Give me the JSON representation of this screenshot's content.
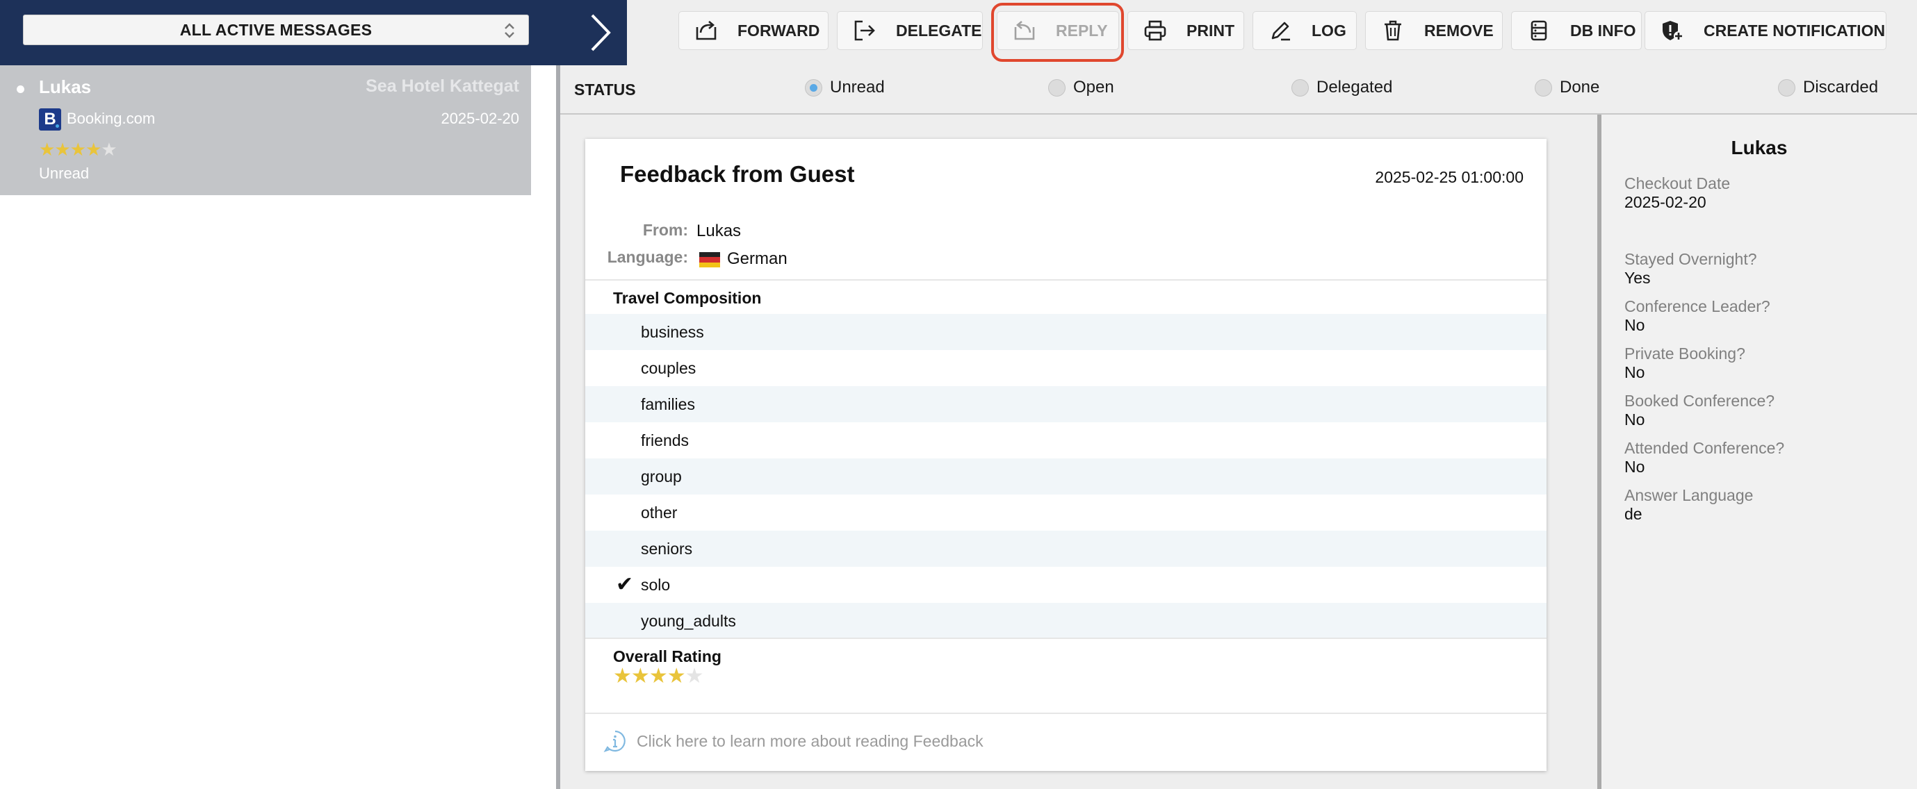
{
  "header": {
    "message_filter": "ALL ACTIVE MESSAGES"
  },
  "toolbar": {
    "forward": "FORWARD",
    "delegate": "DELEGATE",
    "reply": "REPLY",
    "print": "PRINT",
    "log": "LOG",
    "remove": "REMOVE",
    "db_info": "DB INFO",
    "create_notification": "CREATE NOTIFICATION",
    "highlighted_button": "REPLY"
  },
  "message_list": [
    {
      "name": "Lukas",
      "hotel": "Sea Hotel Kattegat",
      "source": "Booking.com",
      "source_logo_letter": "B",
      "date": "2025-02-20",
      "rating": 4,
      "rating_max": 5,
      "status": "Unread"
    }
  ],
  "status_bar": {
    "label": "STATUS",
    "options": [
      "Unread",
      "Open",
      "Delegated",
      "Done",
      "Discarded"
    ],
    "selected": "Unread"
  },
  "feedback": {
    "title": "Feedback from Guest",
    "timestamp": "2025-02-25 01:00:00",
    "from_label": "From:",
    "from_value": "Lukas",
    "language_label": "Language:",
    "language_value": "German",
    "travel_composition_heading": "Travel Composition",
    "travel_composition": [
      {
        "label": "business",
        "checked": false
      },
      {
        "label": "couples",
        "checked": false
      },
      {
        "label": "families",
        "checked": false
      },
      {
        "label": "friends",
        "checked": false
      },
      {
        "label": "group",
        "checked": false
      },
      {
        "label": "other",
        "checked": false
      },
      {
        "label": "seniors",
        "checked": false
      },
      {
        "label": "solo",
        "checked": true
      },
      {
        "label": "young_adults",
        "checked": false
      }
    ],
    "check_mark": "✔",
    "overall_rating_heading": "Overall Rating",
    "overall_rating": 4,
    "overall_rating_max": 5,
    "info_link": "Click here to learn more about reading Feedback"
  },
  "guest_panel": {
    "name": "Lukas",
    "fields": [
      {
        "key": "Checkout Date",
        "value": "2025-02-20"
      },
      {
        "key": "Stayed Overnight?",
        "value": "Yes"
      },
      {
        "key": "Conference Leader?",
        "value": "No"
      },
      {
        "key": "Private Booking?",
        "value": "No"
      },
      {
        "key": "Booked Conference?",
        "value": "No"
      },
      {
        "key": "Attended Conference?",
        "value": "No"
      },
      {
        "key": "Answer Language",
        "value": "de"
      }
    ]
  },
  "colors": {
    "header_navy": "#1d3159",
    "list_selected": "#c3c5c8",
    "star_on": "#e9c43b",
    "radio_selected": "#5aa9e6",
    "highlight_ring": "#e0472e"
  }
}
